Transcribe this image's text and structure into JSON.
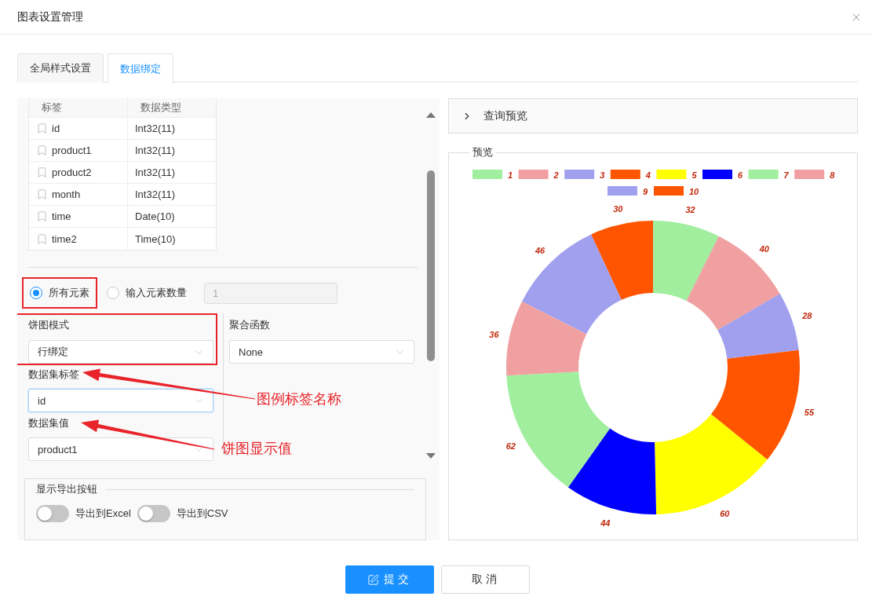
{
  "dialog": {
    "title": "图表设置管理"
  },
  "tabs": [
    {
      "label": "全局样式设置",
      "selected": false
    },
    {
      "label": "数据绑定",
      "selected": true
    }
  ],
  "fields_table": {
    "columns": [
      "标签",
      "数据类型"
    ],
    "rows": [
      {
        "name": "id",
        "type": "Int32(11)"
      },
      {
        "name": "product1",
        "type": "Int32(11)"
      },
      {
        "name": "product2",
        "type": "Int32(11)"
      },
      {
        "name": "month",
        "type": "Int32(11)"
      },
      {
        "name": "time",
        "type": "Date(10)"
      },
      {
        "name": "time2",
        "type": "Time(10)"
      }
    ]
  },
  "element_scope": {
    "options": [
      {
        "label": "所有元素",
        "selected": true,
        "highlighted": true
      },
      {
        "label": "输入元素数量",
        "selected": false,
        "highlighted": false
      }
    ],
    "count_value": "1",
    "count_disabled": true
  },
  "pie_mode": {
    "label": "饼图模式",
    "value": "行绑定",
    "highlighted": true
  },
  "aggregate": {
    "label": "聚合函数",
    "value": "None"
  },
  "dataset_label": {
    "label": "数据集标签",
    "value": "id",
    "focused": true
  },
  "dataset_value": {
    "label": "数据集值",
    "value": "product1",
    "focused": false
  },
  "callouts": [
    {
      "text": "图例标签名称"
    },
    {
      "text": "饼图显示值"
    }
  ],
  "export": {
    "title": "显示导出按钮",
    "toggles": [
      {
        "label": "导出到Excel",
        "on": false
      },
      {
        "label": "导出到CSV",
        "on": false
      }
    ]
  },
  "query_preview": {
    "title": "查询预览",
    "expanded": false
  },
  "preview": {
    "title": "预览",
    "chart_data": {
      "type": "donut",
      "categories": [
        "1",
        "2",
        "3",
        "4",
        "5",
        "6",
        "7",
        "8",
        "9",
        "10"
      ],
      "data_labels": true,
      "legend": "top",
      "series": [
        {
          "values": [
            32,
            40,
            28,
            55,
            60,
            44,
            62,
            36,
            46,
            30
          ]
        }
      ]
    }
  },
  "buttons": [
    {
      "label": "提交",
      "kind": "primary"
    },
    {
      "label": "取消",
      "kind": "default"
    }
  ]
}
